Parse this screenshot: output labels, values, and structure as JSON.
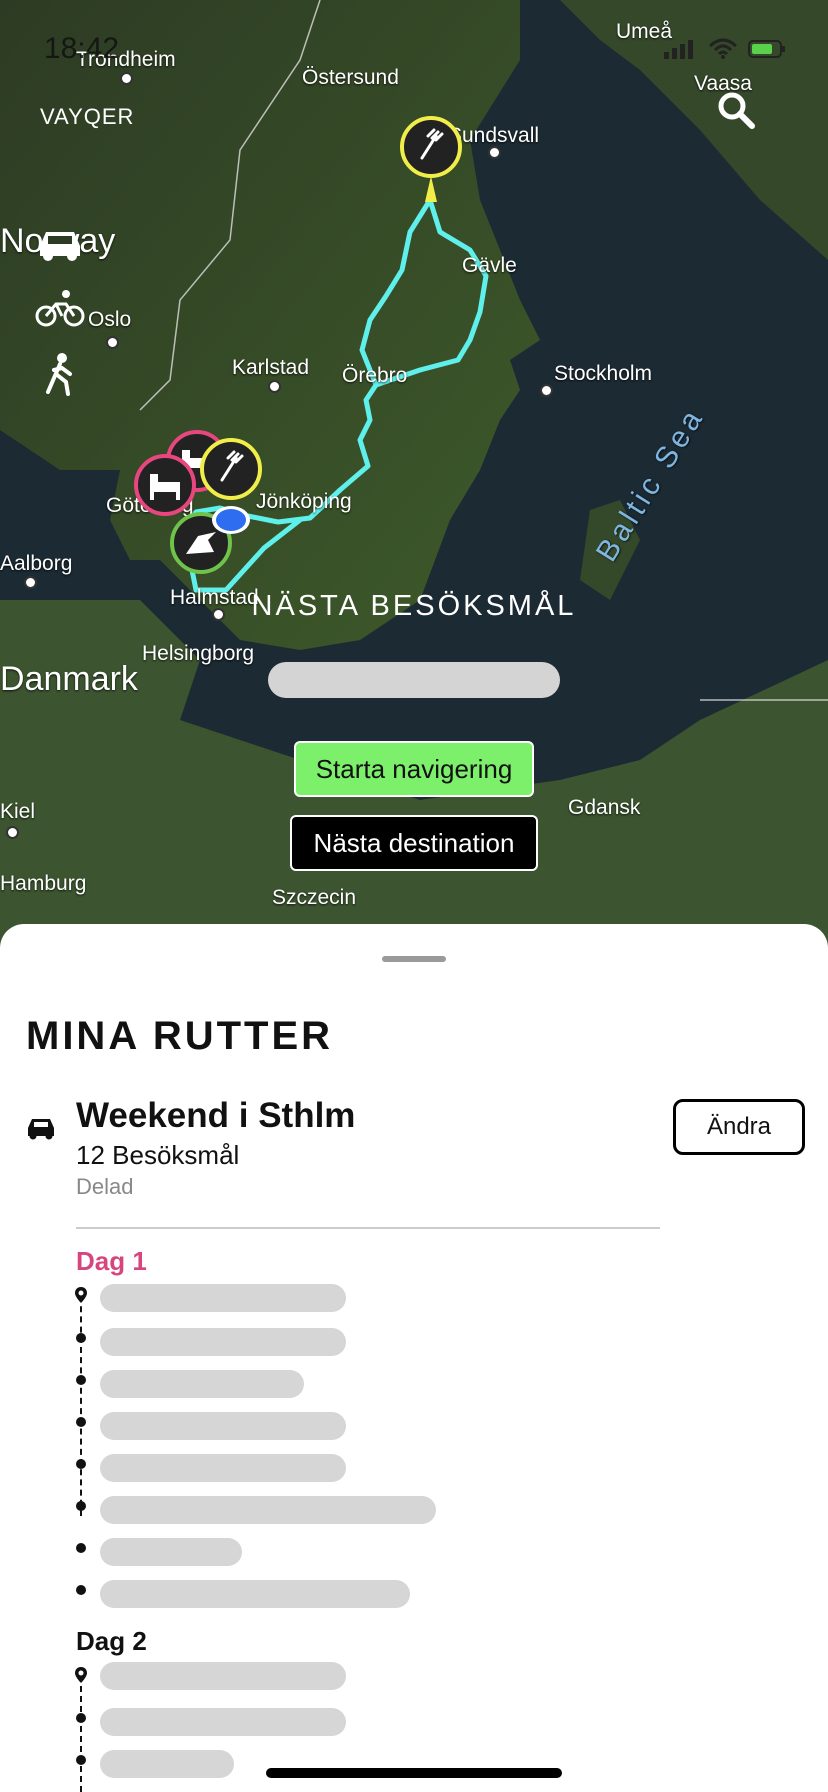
{
  "status": {
    "time": "18:42"
  },
  "brand": "VAYQER",
  "map": {
    "cities": [
      {
        "name": "Trondheim"
      },
      {
        "name": "Östersund"
      },
      {
        "name": "Umeå"
      },
      {
        "name": "Vaasa"
      },
      {
        "name": "Sundsvall"
      },
      {
        "name": "Gävle"
      },
      {
        "name": "Oslo"
      },
      {
        "name": "Karlstad"
      },
      {
        "name": "Örebro"
      },
      {
        "name": "Stockholm"
      },
      {
        "name": "Göteborg"
      },
      {
        "name": "Jönköping"
      },
      {
        "name": "Aalborg"
      },
      {
        "name": "Halmstad"
      },
      {
        "name": "Helsingborg"
      },
      {
        "name": "Gdansk"
      },
      {
        "name": "Kiel"
      },
      {
        "name": "Szczecin"
      },
      {
        "name": "Danmark"
      },
      {
        "name": "Norway"
      },
      {
        "name": "Hamburg"
      }
    ],
    "sea_label": "Baltic Sea",
    "next_label": "NÄSTA BESÖKSMÅL",
    "start_nav": "Starta navigering",
    "next_dest": "Nästa destination",
    "route_color": "#5ff0ec"
  },
  "sheet": {
    "title": "MINA RUTTER",
    "route": {
      "name": "Weekend i Sthlm",
      "count": "12 Besöksmål",
      "shared": "Delad",
      "edit_label": "Ändra"
    },
    "days": [
      {
        "label": "Dag 1",
        "color": "#d6457e"
      },
      {
        "label": "Dag 2",
        "color": "#111111"
      }
    ]
  }
}
